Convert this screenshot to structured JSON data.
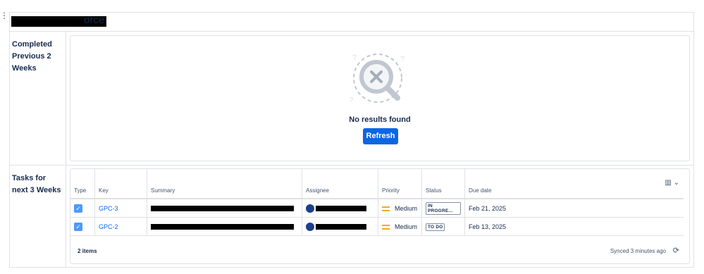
{
  "page": {
    "title_suffix": "orce",
    "handle_glyph": "⋮"
  },
  "section_completed": {
    "label": "Completed Previous 2 Weeks",
    "empty_icon": "search-no-results-icon",
    "message": "No results found",
    "refresh_label": "Refresh"
  },
  "section_tasks": {
    "label": "Tasks for next 3 Weeks",
    "columns": [
      "Type",
      "Key",
      "Summary",
      "Assignee",
      "Priority",
      "Status",
      "Due date"
    ],
    "rows": [
      {
        "type_icon": "task-checkbox-icon",
        "key": "GPC-3",
        "priority": "Medium",
        "status": "IN PROGRE...",
        "due": "Feb 21, 2025"
      },
      {
        "type_icon": "task-checkbox-icon",
        "key": "GPC-2",
        "priority": "Medium",
        "status": "TO DO",
        "due": "Feb 13, 2025"
      }
    ],
    "column_picker_icon": "columns-icon",
    "item_count": "2 items",
    "sync_text": "Synced 3 minutes ago",
    "sync_icon": "refresh-icon"
  },
  "colors": {
    "accent": "#0c66e4",
    "task_icon": "#4c9aff",
    "priority_medium": "#f5a623",
    "border": "#dfe1e6"
  }
}
